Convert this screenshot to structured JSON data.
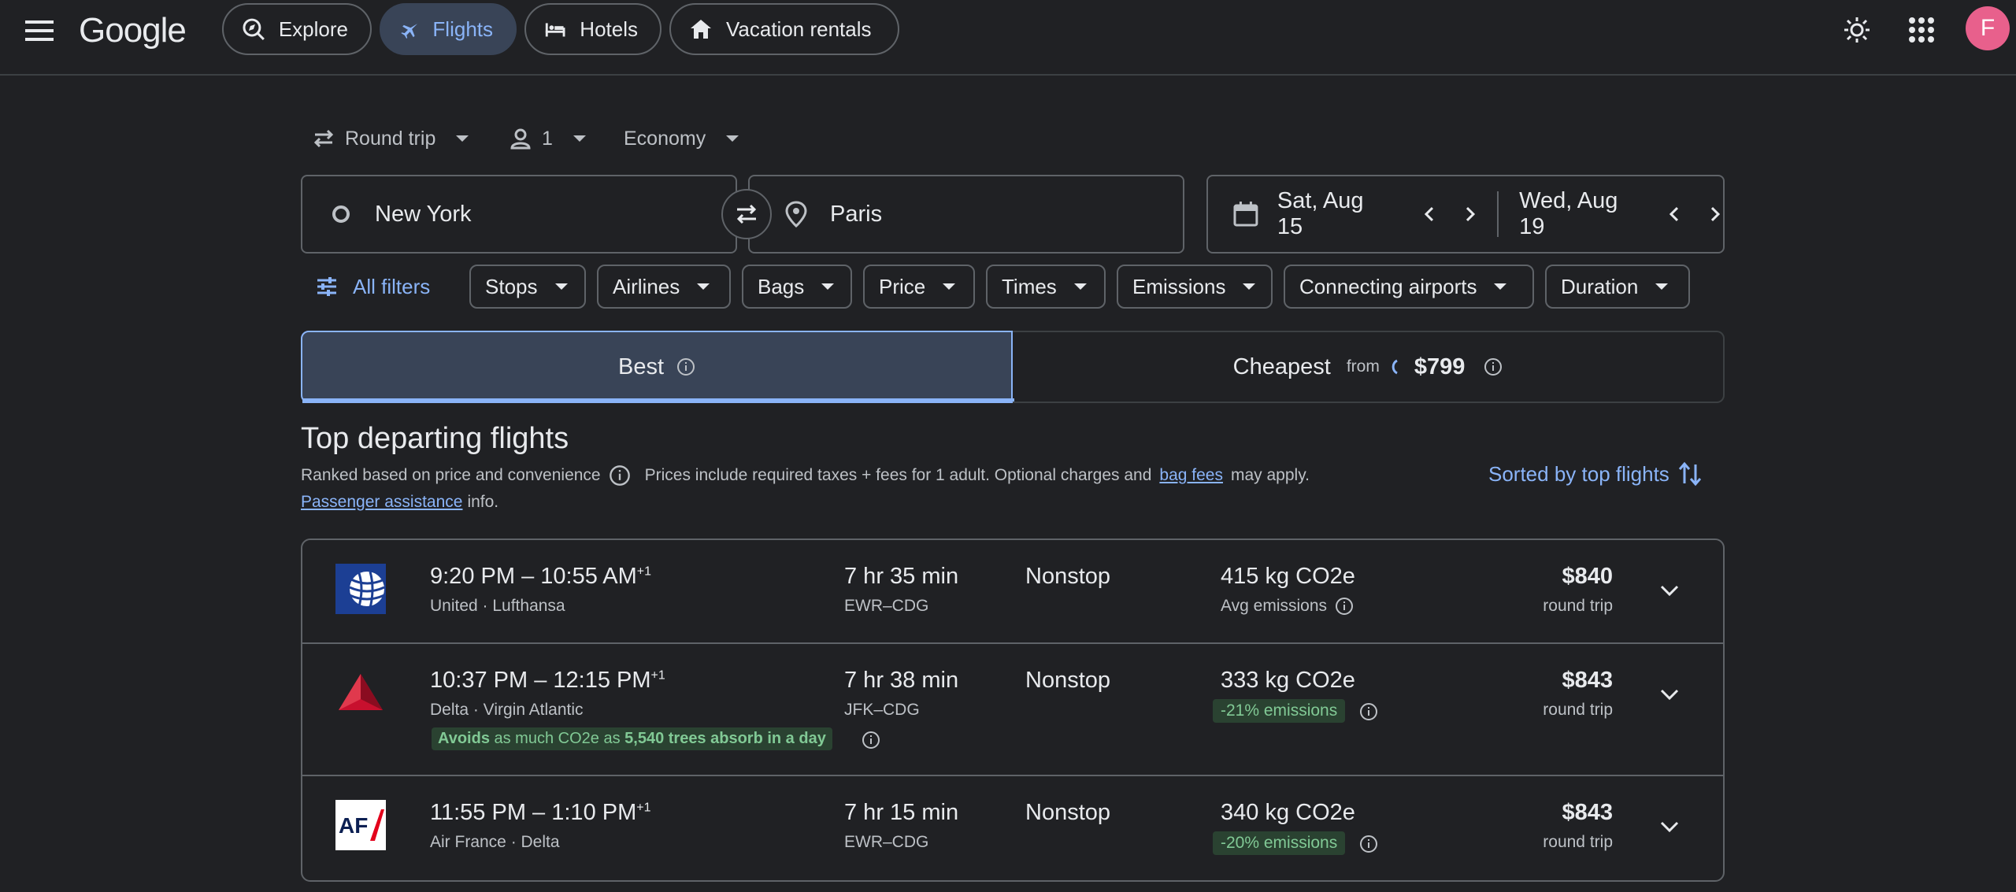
{
  "header": {
    "logo": "Google",
    "nav": [
      {
        "label": "Explore"
      },
      {
        "label": "Flights"
      },
      {
        "label": "Hotels"
      },
      {
        "label": "Vacation rentals"
      }
    ],
    "avatar_letter": "F"
  },
  "trip": {
    "type": "Round trip",
    "passengers": "1",
    "cabin": "Economy"
  },
  "search": {
    "origin": "New York",
    "destination": "Paris",
    "depart": "Sat, Aug 15",
    "return": "Wed, Aug 19"
  },
  "filters": {
    "all": "All filters",
    "chips": [
      "Stops",
      "Airlines",
      "Bags",
      "Price",
      "Times",
      "Emissions",
      "Connecting airports",
      "Duration"
    ]
  },
  "tabs": {
    "best": "Best",
    "cheapest": "Cheapest",
    "cheapest_from": "from",
    "cheapest_price": "$799"
  },
  "section": {
    "title": "Top departing flights",
    "ranked": "Ranked based on price and convenience",
    "prices_note": "Prices include required taxes + fees for 1 adult. Optional charges and",
    "bag_fees": "bag fees",
    "may_apply": "may apply.",
    "passenger_assistance": "Passenger assistance",
    "info": "info.",
    "sort_label": "Sorted by top flights"
  },
  "flights": [
    {
      "depart": "9:20 PM",
      "arrive": "10:55 AM",
      "plus": "+1",
      "dash": "–",
      "airlines": "United · Lufthansa",
      "duration": "7 hr 35 min",
      "route": "EWR–CDG",
      "stops": "Nonstop",
      "emissions": "415 kg CO2e",
      "emissions_note": "Avg emissions",
      "price": "$840",
      "price_type": "round trip"
    },
    {
      "depart": "10:37 PM",
      "arrive": "12:15 PM",
      "plus": "+1",
      "dash": "–",
      "airlines": "Delta · Virgin Atlantic",
      "duration": "7 hr 38 min",
      "route": "JFK–CDG",
      "stops": "Nonstop",
      "emissions": "333 kg CO2e",
      "emissions_note": "-21% emissions",
      "price": "$843",
      "price_type": "round trip",
      "avoid_a": "Avoids",
      "avoid_b": "as much CO2e as",
      "avoid_c": "5,540 trees absorb in a day"
    },
    {
      "depart": "11:55 PM",
      "arrive": "1:10 PM",
      "plus": "+1",
      "dash": "–",
      "airlines": "Air France · Delta",
      "duration": "7 hr 15 min",
      "route": "EWR–CDG",
      "stops": "Nonstop",
      "emissions": "340 kg CO2e",
      "emissions_note": "-20% emissions",
      "price": "$843",
      "price_type": "round trip"
    }
  ],
  "colors": {
    "background": "#202124",
    "accent": "#8ab4f8",
    "active_tab": "#394457",
    "green": "#81c995",
    "avatar": "#e8608c"
  }
}
